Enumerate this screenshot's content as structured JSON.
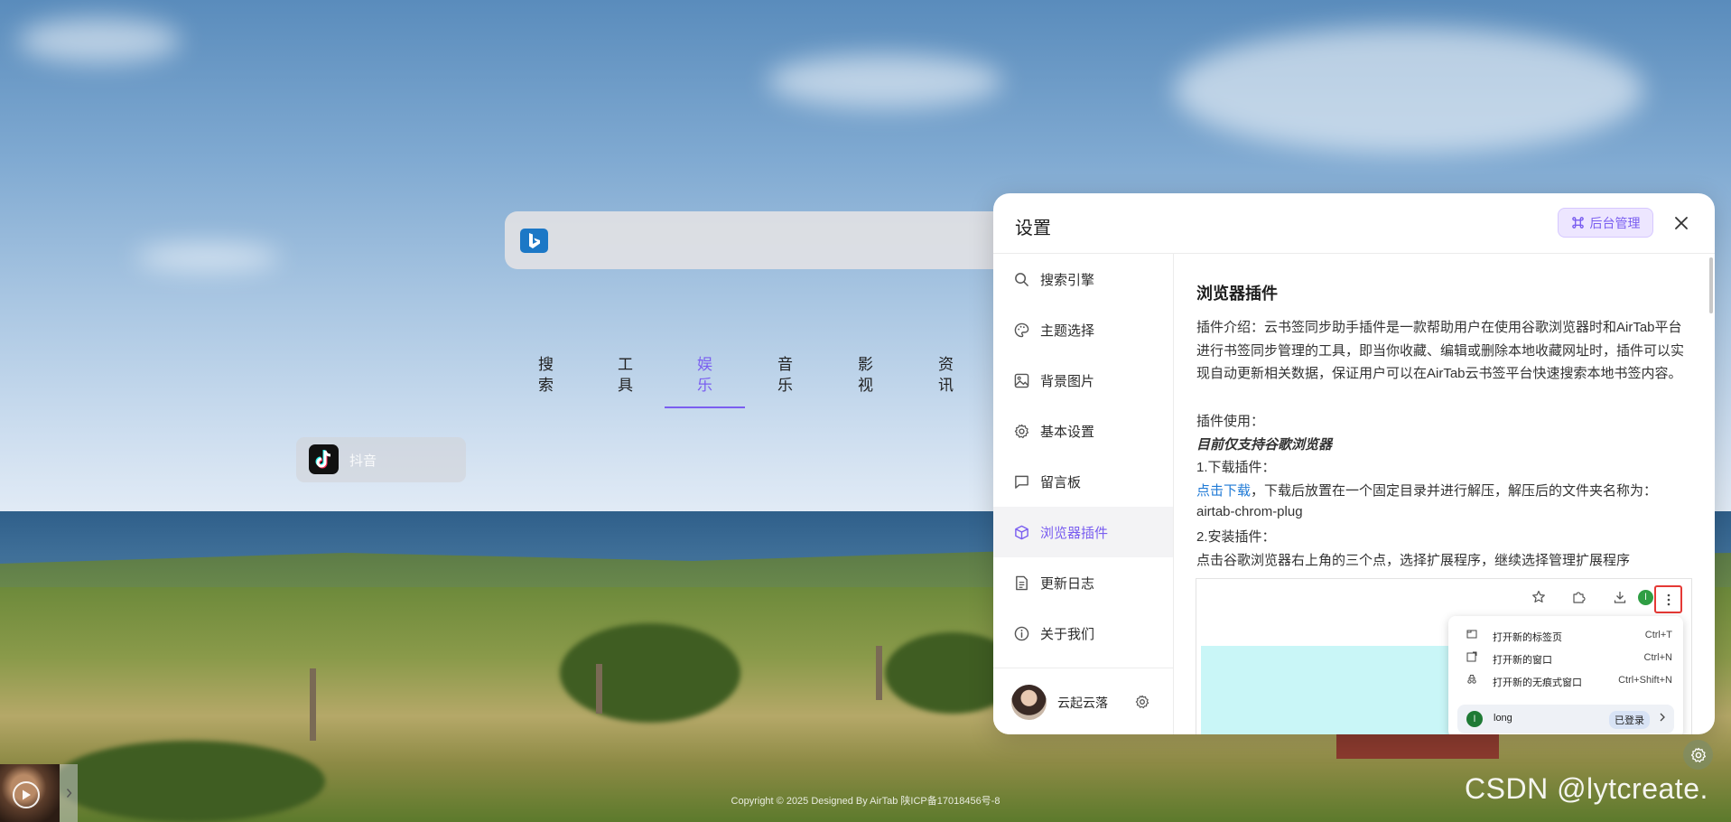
{
  "search": {
    "engine_icon": "bing-icon"
  },
  "categories": [
    {
      "label": "搜索",
      "active": false
    },
    {
      "label": "工具",
      "active": false
    },
    {
      "label": "娱乐",
      "active": true
    },
    {
      "label": "音乐",
      "active": false
    },
    {
      "label": "影视",
      "active": false
    },
    {
      "label": "资讯",
      "active": false
    }
  ],
  "apps": [
    {
      "label": "抖音",
      "icon": "douyin-icon"
    }
  ],
  "dialog": {
    "title": "设置",
    "admin_button": "后台管理",
    "sidebar": [
      {
        "label": "搜索引擎",
        "icon": "search-icon"
      },
      {
        "label": "主题选择",
        "icon": "palette-icon"
      },
      {
        "label": "背景图片",
        "icon": "image-icon"
      },
      {
        "label": "基本设置",
        "icon": "gear-icon"
      },
      {
        "label": "留言板",
        "icon": "message-icon"
      },
      {
        "label": "浏览器插件",
        "icon": "cube-icon",
        "active": true
      },
      {
        "label": "更新日志",
        "icon": "document-icon"
      },
      {
        "label": "关于我们",
        "icon": "info-icon"
      }
    ],
    "user": {
      "name": "云起云落"
    },
    "content": {
      "title": "浏览器插件",
      "intro": "插件介绍：云书签同步助手插件是一款帮助用户在使用谷歌浏览器时和AirTab平台进行书签同步管理的工具，即当你收藏、编辑或删除本地收藏网址时，插件可以实现自动更新相关数据，保证用户可以在AirTab云书签平台快速搜索本地书签内容。",
      "usage_label": "插件使用：",
      "chrome_only": "目前仅支持谷歌浏览器",
      "step1_label": "1.下载插件：",
      "download_link": "点击下载",
      "step1_text": "，下载后放置在一个固定目录并进行解压，解压后的文件夹名称为：",
      "folder_name": "airtab-chrom-plug",
      "step2_label": "2.安装插件：",
      "step2_text": "点击谷歌浏览器右上角的三个点，选择扩展程序，继续选择管理扩展程序",
      "screenshot": {
        "profile_badge": "l",
        "menu": [
          {
            "label": "打开新的标签页",
            "shortcut": "Ctrl+T"
          },
          {
            "label": "打开新的窗口",
            "shortcut": "Ctrl+N"
          },
          {
            "label": "打开新的无痕式窗口",
            "shortcut": "Ctrl+Shift+N"
          }
        ],
        "account": {
          "badge": "l",
          "name": "long",
          "status": "已登录"
        }
      }
    }
  },
  "footer": {
    "copyright": "Copyright © 2025 Designed By AirTab 陕ICP备17018456号-8"
  },
  "watermark": "CSDN @lytcreate."
}
